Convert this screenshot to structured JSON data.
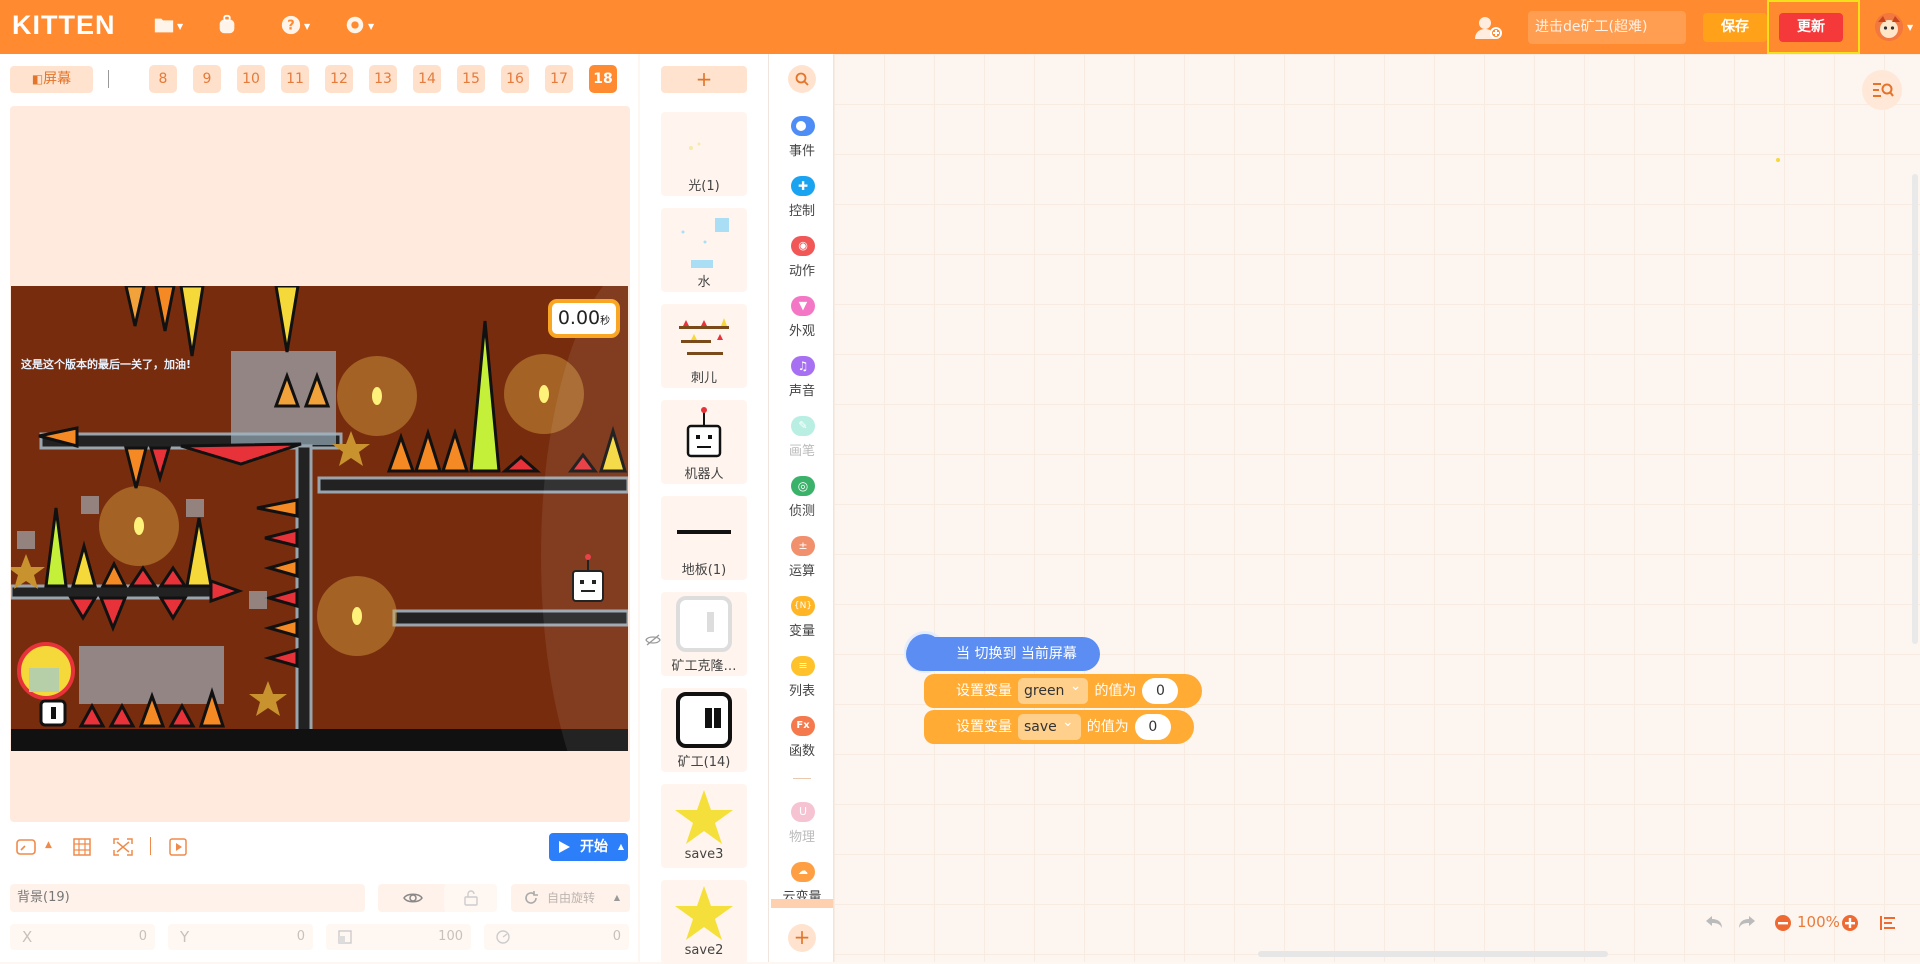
{
  "app": {
    "logo": "KITTEN"
  },
  "topbar": {
    "project_name": "进击de矿工(超难)",
    "save_label": "保存",
    "update_label": "更新"
  },
  "stage": {
    "screen_button": "屏幕",
    "tabs": [
      "8",
      "9",
      "10",
      "11",
      "12",
      "13",
      "14",
      "15",
      "16",
      "17",
      "18"
    ],
    "active_tab": "18",
    "timer": {
      "value": "0.00",
      "unit": "秒"
    },
    "banner_text": "这是这个版本的最后一关了，加油!",
    "start_label": "开始"
  },
  "sprite_props": {
    "name": "背景(19)",
    "rotate_label": "自由旋转",
    "x_label": "X",
    "x_value": "0",
    "y_label": "Y",
    "y_value": "0",
    "size_value": "100",
    "dir_value": "0"
  },
  "sprites": [
    {
      "name": "光(1)"
    },
    {
      "name": "水"
    },
    {
      "name": "刺儿"
    },
    {
      "name": "机器人"
    },
    {
      "name": "地板(1)"
    },
    {
      "name": "矿工克隆…"
    },
    {
      "name": "矿工(14)"
    },
    {
      "name": "save3"
    },
    {
      "name": "save2"
    }
  ],
  "categories": [
    {
      "label": "事件",
      "color": "#4f8df6"
    },
    {
      "label": "控制",
      "color": "#1aa3f0"
    },
    {
      "label": "动作",
      "color": "#f25757"
    },
    {
      "label": "外观",
      "color": "#f477c6"
    },
    {
      "label": "声音",
      "color": "#a770f2"
    },
    {
      "label": "画笔",
      "color": "#8fe2cf"
    },
    {
      "label": "侦测",
      "color": "#3bb26a"
    },
    {
      "label": "运算",
      "color": "#f0906c"
    },
    {
      "label": "变量",
      "color": "#ffb526"
    },
    {
      "label": "列表",
      "color": "#ffc22a"
    },
    {
      "label": "函数",
      "color": "#f47a4e"
    },
    {
      "label": "物理",
      "color": "#f3a6bd"
    },
    {
      "label": "云变量",
      "color": "#ff9f43"
    }
  ],
  "blocks": {
    "hat": "当 切换到 当前屏幕",
    "set1": {
      "label": "设置变量",
      "var": "green",
      "suffix": "的值为",
      "value": "0"
    },
    "set2": {
      "label": "设置变量",
      "var": "save",
      "suffix": "的值为",
      "value": "0"
    }
  },
  "workspace": {
    "zoom": "100%"
  }
}
